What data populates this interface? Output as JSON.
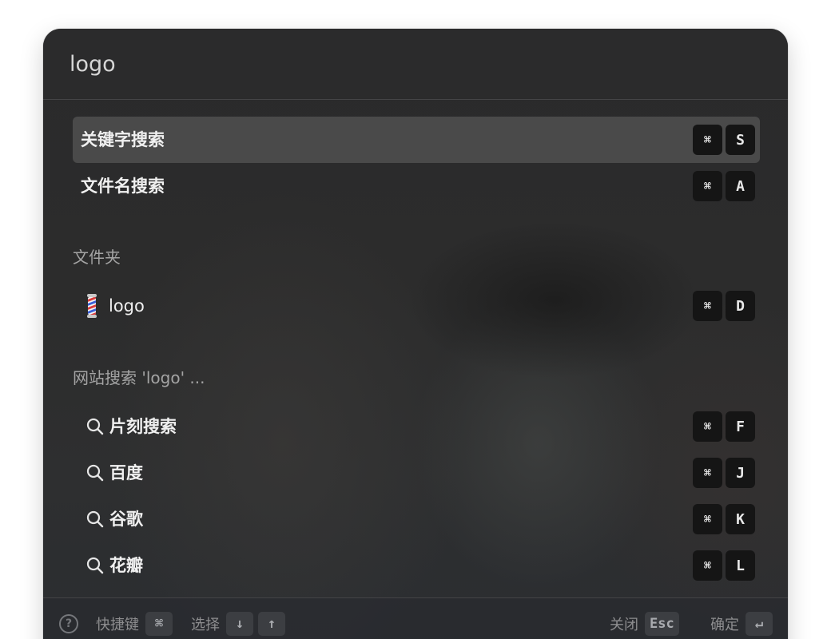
{
  "search": {
    "value": "logo"
  },
  "actions": [
    {
      "label": "关键字搜索",
      "keys": [
        "⌘",
        "S"
      ]
    },
    {
      "label": "文件名搜索",
      "keys": [
        "⌘",
        "A"
      ]
    }
  ],
  "folder_section": {
    "title": "文件夹",
    "items": [
      {
        "label": "logo",
        "icon": "barber-pole-icon",
        "keys": [
          "⌘",
          "D"
        ]
      }
    ]
  },
  "web_section": {
    "title": "网站搜索 'logo' ...",
    "items": [
      {
        "label": "片刻搜索",
        "icon": "search-icon",
        "keys": [
          "⌘",
          "F"
        ]
      },
      {
        "label": "百度",
        "icon": "search-icon",
        "keys": [
          "⌘",
          "J"
        ]
      },
      {
        "label": "谷歌",
        "icon": "search-icon",
        "keys": [
          "⌘",
          "K"
        ]
      },
      {
        "label": "花瓣",
        "icon": "search-icon",
        "keys": [
          "⌘",
          "L"
        ]
      }
    ]
  },
  "footer": {
    "help_icon": "?",
    "shortcut_label": "快捷键",
    "shortcut_key": "⌘",
    "select_label": "选择",
    "down_key": "↓",
    "up_key": "↑",
    "close_label": "关闭",
    "close_key": "Esc",
    "confirm_label": "确定",
    "confirm_key": "↵"
  },
  "colors": {
    "panel_bg": "#2b2b2c",
    "active_row": "#4a4a4a",
    "key_bg": "#151515"
  }
}
